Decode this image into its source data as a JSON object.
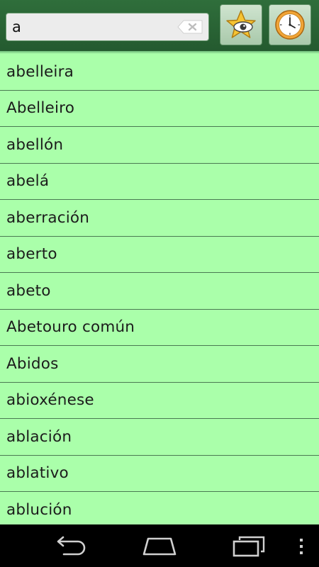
{
  "search": {
    "value": "a",
    "placeholder": ""
  },
  "icons": {
    "clear": "backspace-clear-icon",
    "favorites": "star-eye-icon",
    "history": "clock-icon",
    "back": "back-arrow-icon",
    "home": "home-icon",
    "recent": "recent-apps-icon",
    "menu": "overflow-menu-icon"
  },
  "words": [
    "abelleira",
    "Abelleiro",
    "abellón",
    "abelá",
    "aberración",
    "aberto",
    "abeto",
    "Abetouro común",
    "Abidos",
    "abioxénese",
    "ablación",
    "ablativo",
    "ablución"
  ],
  "colors": {
    "list_background": "#aaffaa",
    "topbar": "#2f6e3b",
    "divider": "#4a7a52",
    "navbar": "#000000"
  }
}
